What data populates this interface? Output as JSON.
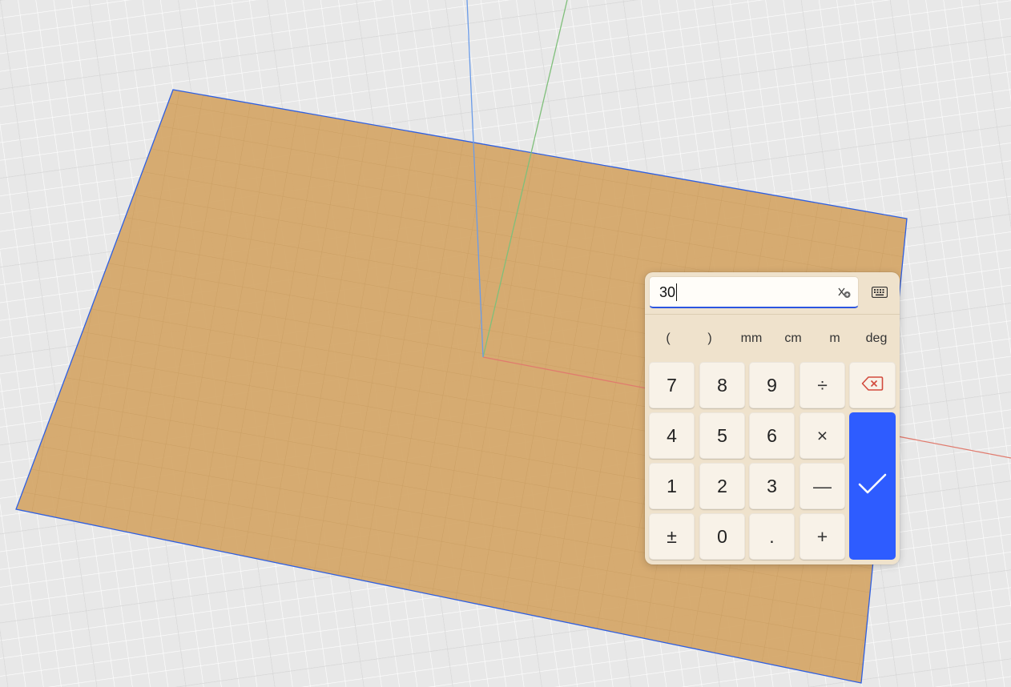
{
  "calculator": {
    "input_value": "30",
    "clear_icon": "clear-expression-icon",
    "keyboard_icon": "keyboard-icon",
    "units": [
      "(",
      ")",
      "mm",
      "cm",
      "m",
      "deg"
    ],
    "keys": {
      "row1": [
        "7",
        "8",
        "9",
        "÷"
      ],
      "row2": [
        "4",
        "5",
        "6",
        "×"
      ],
      "row3": [
        "1",
        "2",
        "3",
        "—"
      ],
      "row4": [
        "±",
        "0",
        ".",
        "+"
      ]
    },
    "backspace_icon": "backspace-icon",
    "enter_icon": "checkmark-icon",
    "accent_color": "#2e5cff",
    "panel_color": "#efe2cc"
  },
  "scene": {
    "plane_color": "#d5a86a",
    "plane_edge_color": "#2f5fe0",
    "axis_x_color": "#e07b6e",
    "axis_y_color": "#7fbf7a",
    "axis_z_color": "#6a9be8"
  }
}
